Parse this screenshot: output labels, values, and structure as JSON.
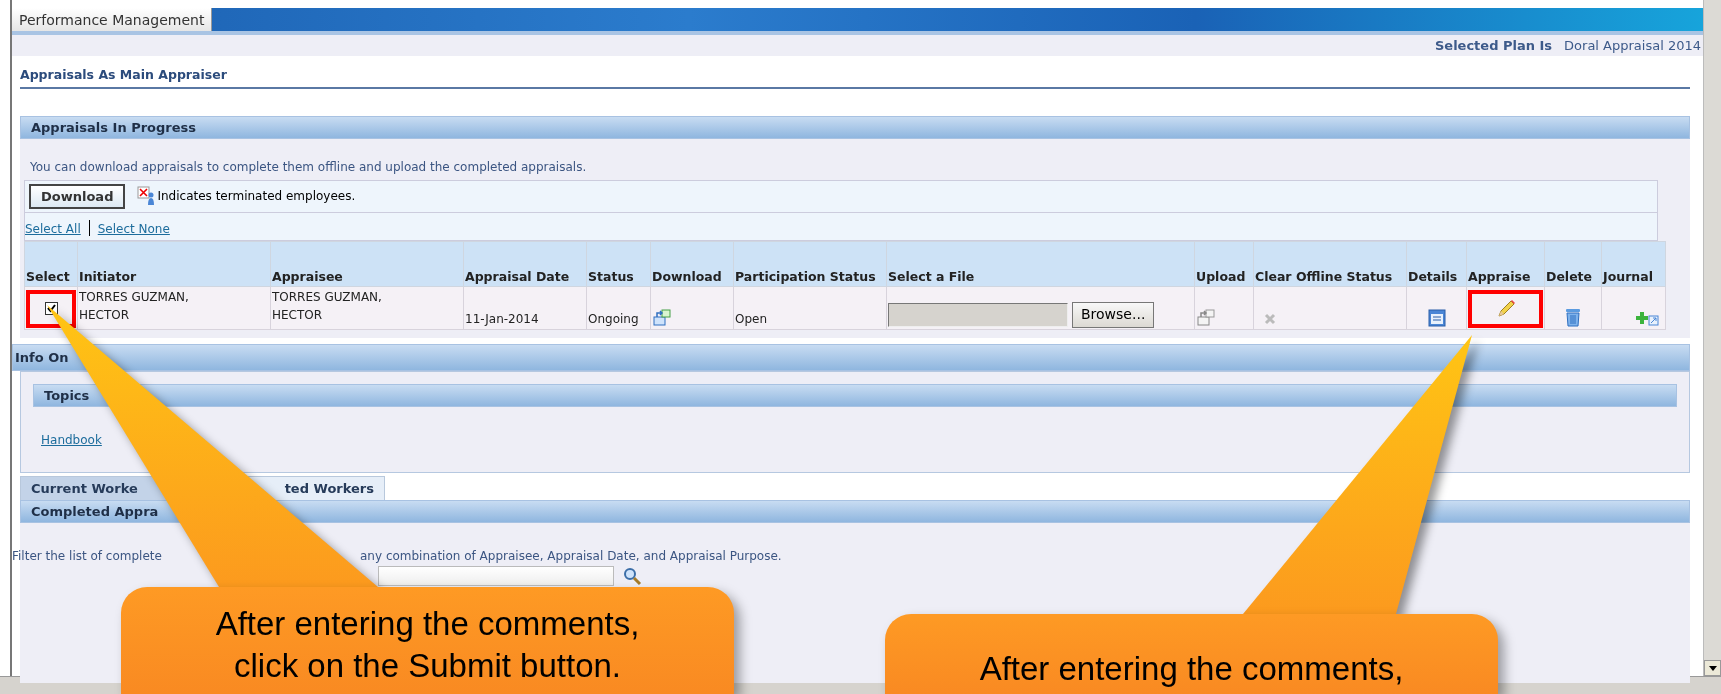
{
  "app_tab": {
    "label": "Performance Management",
    "selected": true
  },
  "plan": {
    "label": "Selected Plan Is",
    "value": "Doral Appraisal 2014"
  },
  "page_title": "Appraisals As Main Appraiser",
  "in_progress": {
    "title": "Appraisals In Progress",
    "instructions": "You can download appraisals to complete them offline and upload the completed appraisals.",
    "download_button": "Download",
    "legend": "Indicates terminated employees.",
    "select_links": [
      "Select All",
      "Select None"
    ],
    "columns": [
      {
        "kind": "select",
        "label": "Select",
        "highlighted": true
      },
      {
        "kind": "initiator",
        "label": "Initiator",
        "highlighted": false
      },
      {
        "kind": "appraisee",
        "label": "Appraisee",
        "highlighted": false
      },
      {
        "kind": "date",
        "label": "Appraisal Date",
        "highlighted": false
      },
      {
        "kind": "status",
        "label": "Status",
        "highlighted": false
      },
      {
        "kind": "download",
        "label": "Download",
        "highlighted": false
      },
      {
        "kind": "participation",
        "label": "Participation Status",
        "highlighted": false
      },
      {
        "kind": "file",
        "label": "Select a File",
        "highlighted": false
      },
      {
        "kind": "upload",
        "label": "Upload",
        "highlighted": false
      },
      {
        "kind": "clear",
        "label": "Clear Offline Status",
        "highlighted": false
      },
      {
        "kind": "details",
        "label": "Details",
        "highlighted": false
      },
      {
        "kind": "appraise",
        "label": "Appraise",
        "highlighted": true
      },
      {
        "kind": "delete",
        "label": "Delete",
        "highlighted": false
      },
      {
        "kind": "journal",
        "label": "Journal",
        "highlighted": false
      }
    ],
    "rows": [
      {
        "selected": true,
        "initiator": "TORRES GUZMAN, HECTOR",
        "appraisee": "TORRES GUZMAN, HECTOR",
        "appraisal_date": "11-Jan-2014",
        "status": "Ongoing",
        "participation_status": "Open",
        "browse_button": "Browse..."
      }
    ]
  },
  "info_online": {
    "title": "Info On",
    "topics_title": "Topics",
    "links": [
      "Handbook"
    ]
  },
  "worker_tabs": [
    {
      "label": "Current Worke",
      "selected": false
    },
    {
      "label": "ted Workers",
      "selected": true
    }
  ],
  "completed": {
    "title": "Completed Appra",
    "filter_text": [
      "Filter the list of complete",
      "any combination of Appraisee, Appraisal Date, and Appraisal Purpose."
    ]
  },
  "callouts": [
    {
      "kind": "select",
      "lines": [
        "After entering the comments,",
        "click on the Submit button."
      ]
    },
    {
      "kind": "appraise",
      "lines": [
        "After entering the comments,"
      ]
    }
  ]
}
